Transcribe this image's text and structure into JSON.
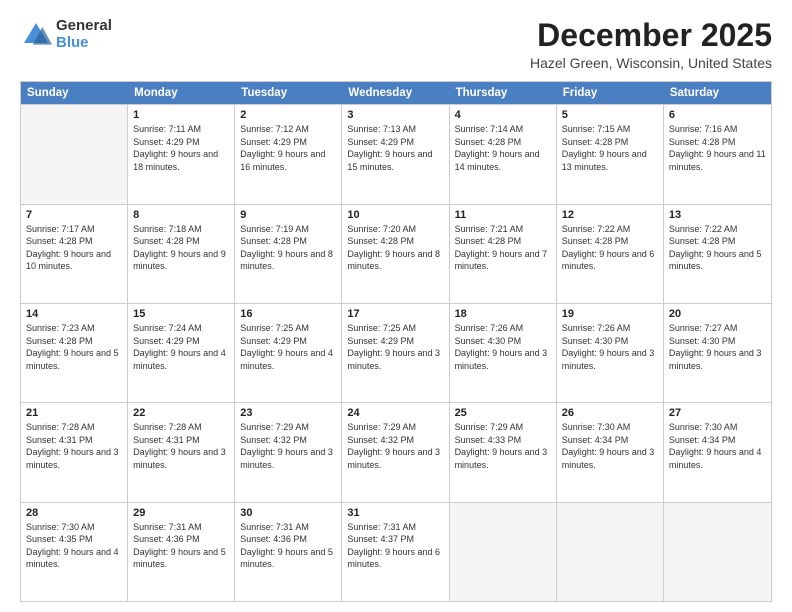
{
  "logo": {
    "general": "General",
    "blue": "Blue"
  },
  "title": "December 2025",
  "subtitle": "Hazel Green, Wisconsin, United States",
  "days_of_week": [
    "Sunday",
    "Monday",
    "Tuesday",
    "Wednesday",
    "Thursday",
    "Friday",
    "Saturday"
  ],
  "weeks": [
    [
      {
        "day": "",
        "empty": true
      },
      {
        "day": "1",
        "sunrise": "7:11 AM",
        "sunset": "4:29 PM",
        "daylight": "9 hours and 18 minutes."
      },
      {
        "day": "2",
        "sunrise": "7:12 AM",
        "sunset": "4:29 PM",
        "daylight": "9 hours and 16 minutes."
      },
      {
        "day": "3",
        "sunrise": "7:13 AM",
        "sunset": "4:29 PM",
        "daylight": "9 hours and 15 minutes."
      },
      {
        "day": "4",
        "sunrise": "7:14 AM",
        "sunset": "4:28 PM",
        "daylight": "9 hours and 14 minutes."
      },
      {
        "day": "5",
        "sunrise": "7:15 AM",
        "sunset": "4:28 PM",
        "daylight": "9 hours and 13 minutes."
      },
      {
        "day": "6",
        "sunrise": "7:16 AM",
        "sunset": "4:28 PM",
        "daylight": "9 hours and 11 minutes."
      }
    ],
    [
      {
        "day": "7",
        "sunrise": "7:17 AM",
        "sunset": "4:28 PM",
        "daylight": "9 hours and 10 minutes."
      },
      {
        "day": "8",
        "sunrise": "7:18 AM",
        "sunset": "4:28 PM",
        "daylight": "9 hours and 9 minutes."
      },
      {
        "day": "9",
        "sunrise": "7:19 AM",
        "sunset": "4:28 PM",
        "daylight": "9 hours and 8 minutes."
      },
      {
        "day": "10",
        "sunrise": "7:20 AM",
        "sunset": "4:28 PM",
        "daylight": "9 hours and 8 minutes."
      },
      {
        "day": "11",
        "sunrise": "7:21 AM",
        "sunset": "4:28 PM",
        "daylight": "9 hours and 7 minutes."
      },
      {
        "day": "12",
        "sunrise": "7:22 AM",
        "sunset": "4:28 PM",
        "daylight": "9 hours and 6 minutes."
      },
      {
        "day": "13",
        "sunrise": "7:22 AM",
        "sunset": "4:28 PM",
        "daylight": "9 hours and 5 minutes."
      }
    ],
    [
      {
        "day": "14",
        "sunrise": "7:23 AM",
        "sunset": "4:28 PM",
        "daylight": "9 hours and 5 minutes."
      },
      {
        "day": "15",
        "sunrise": "7:24 AM",
        "sunset": "4:29 PM",
        "daylight": "9 hours and 4 minutes."
      },
      {
        "day": "16",
        "sunrise": "7:25 AM",
        "sunset": "4:29 PM",
        "daylight": "9 hours and 4 minutes."
      },
      {
        "day": "17",
        "sunrise": "7:25 AM",
        "sunset": "4:29 PM",
        "daylight": "9 hours and 3 minutes."
      },
      {
        "day": "18",
        "sunrise": "7:26 AM",
        "sunset": "4:30 PM",
        "daylight": "9 hours and 3 minutes."
      },
      {
        "day": "19",
        "sunrise": "7:26 AM",
        "sunset": "4:30 PM",
        "daylight": "9 hours and 3 minutes."
      },
      {
        "day": "20",
        "sunrise": "7:27 AM",
        "sunset": "4:30 PM",
        "daylight": "9 hours and 3 minutes."
      }
    ],
    [
      {
        "day": "21",
        "sunrise": "7:28 AM",
        "sunset": "4:31 PM",
        "daylight": "9 hours and 3 minutes."
      },
      {
        "day": "22",
        "sunrise": "7:28 AM",
        "sunset": "4:31 PM",
        "daylight": "9 hours and 3 minutes."
      },
      {
        "day": "23",
        "sunrise": "7:29 AM",
        "sunset": "4:32 PM",
        "daylight": "9 hours and 3 minutes."
      },
      {
        "day": "24",
        "sunrise": "7:29 AM",
        "sunset": "4:32 PM",
        "daylight": "9 hours and 3 minutes."
      },
      {
        "day": "25",
        "sunrise": "7:29 AM",
        "sunset": "4:33 PM",
        "daylight": "9 hours and 3 minutes."
      },
      {
        "day": "26",
        "sunrise": "7:30 AM",
        "sunset": "4:34 PM",
        "daylight": "9 hours and 3 minutes."
      },
      {
        "day": "27",
        "sunrise": "7:30 AM",
        "sunset": "4:34 PM",
        "daylight": "9 hours and 4 minutes."
      }
    ],
    [
      {
        "day": "28",
        "sunrise": "7:30 AM",
        "sunset": "4:35 PM",
        "daylight": "9 hours and 4 minutes."
      },
      {
        "day": "29",
        "sunrise": "7:31 AM",
        "sunset": "4:36 PM",
        "daylight": "9 hours and 5 minutes."
      },
      {
        "day": "30",
        "sunrise": "7:31 AM",
        "sunset": "4:36 PM",
        "daylight": "9 hours and 5 minutes."
      },
      {
        "day": "31",
        "sunrise": "7:31 AM",
        "sunset": "4:37 PM",
        "daylight": "9 hours and 6 minutes."
      },
      {
        "day": "",
        "empty": true
      },
      {
        "day": "",
        "empty": true
      },
      {
        "day": "",
        "empty": true
      }
    ]
  ]
}
